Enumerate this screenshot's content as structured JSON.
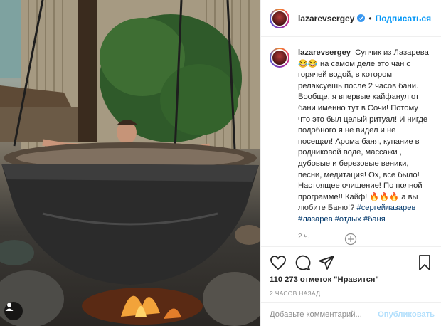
{
  "post": {
    "username": "lazarevsergey",
    "follow_label": "Подписаться",
    "dot": "•",
    "caption": {
      "username": "lazarevsergey",
      "text": "Супчик из Лазарева 😂😂 на самом деле это чан с горячей водой, в котором релаксуешь после 2 часов бани. Вообще, я впервые кайфанул от бани именно тут в Сочи! Потому что это был целый ритуал! И нигде подобного я не видел и не посещал! Арома баня, купание в родниковой воде, массажи , дубовые и березовые веники, песни, медитация! Ох, все было! Настоящее очищение! По полной программе!! Кайф! 🔥🔥🔥 а вы любите Баню!? ",
      "hashtags_inline": "#сергейлазарев",
      "hashtags_line2": "#лазарев #отдых #баня",
      "time": "2 ч."
    },
    "likes": "110 273 отметок \"Нравится\"",
    "posted_ago": "2 ЧАСОВ НАЗАД",
    "comment_placeholder": "Добавьте комментарий...",
    "publish_label": "Опубликовать"
  },
  "icons": {
    "like": "heart-icon",
    "comment": "comment-icon",
    "share": "share-icon",
    "save": "bookmark-icon",
    "verified": "verified-badge-icon",
    "more": "plus-circle-icon",
    "tagged": "person-tag-icon"
  },
  "colors": {
    "accent": "#0095f6",
    "text": "#262626",
    "muted": "#8e8e8e",
    "hashtag": "#00376b",
    "publish_disabled": "#b2dffc"
  }
}
